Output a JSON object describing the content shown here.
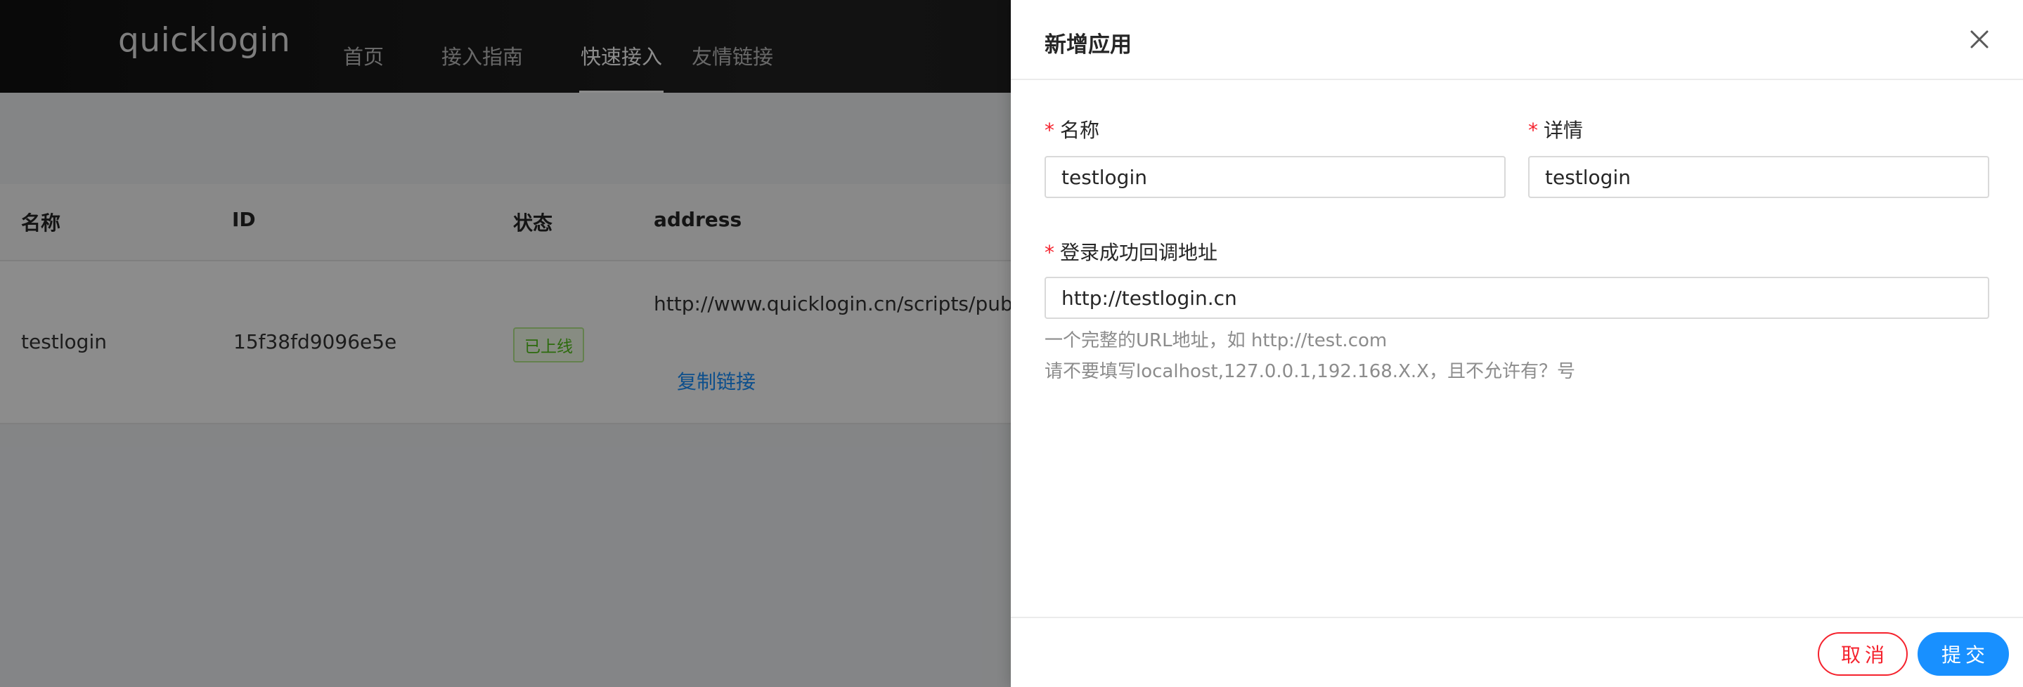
{
  "header": {
    "logo": "quicklogin",
    "nav": [
      {
        "label": "首页"
      },
      {
        "label": "接入指南"
      },
      {
        "label": "快速接入",
        "active": true
      },
      {
        "label": "友情链接"
      }
    ]
  },
  "table": {
    "columns": [
      "名称",
      "ID",
      "状态",
      "address"
    ],
    "rows": [
      {
        "name": "testlogin",
        "id": "15f38fd9096e5e",
        "status": "已上线",
        "address": "http://www.quicklogin.cn/scripts/public/",
        "copy_link": "复制链接"
      }
    ]
  },
  "drawer": {
    "title": "新增应用",
    "close_icon": "close-icon",
    "fields": {
      "name": {
        "label": "名称",
        "value": "testlogin",
        "required": true
      },
      "detail": {
        "label": "详情",
        "value": "testlogin",
        "required": true
      },
      "callback": {
        "label": "登录成功回调地址",
        "value": "http://testlogin.cn",
        "required": true,
        "help": [
          "一个完整的URL地址，如 http://test.com",
          "请不要填写localhost,127.0.0.1,192.168.X.X，且不允许有？号"
        ]
      }
    },
    "required_mark": "*",
    "footer": {
      "cancel": "取消",
      "submit": "提交"
    }
  },
  "colors": {
    "primary": "#1890ff",
    "danger": "#f5222d",
    "success": "#52c41a",
    "header_bg": "#1a1a1a"
  }
}
